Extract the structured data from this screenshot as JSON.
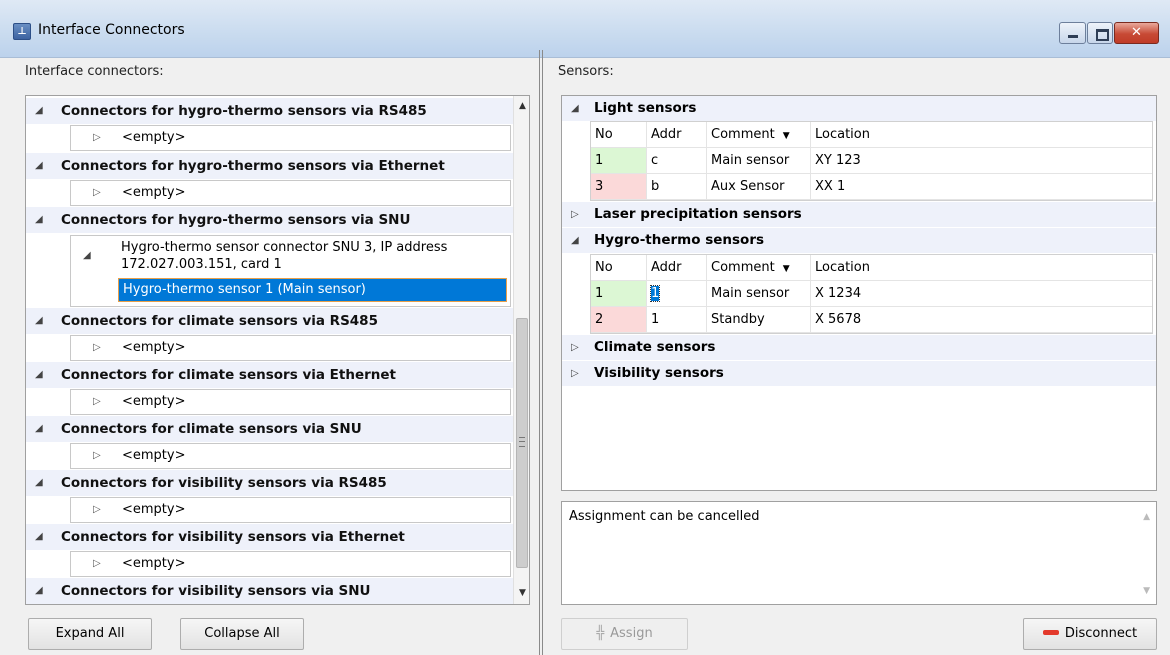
{
  "window": {
    "title": "Interface Connectors",
    "close_glyph": "✕"
  },
  "left": {
    "label": "Interface connectors:",
    "groups": [
      {
        "label": "Connectors for hygro-thermo sensors via RS485",
        "child": "<empty>"
      },
      {
        "label": "Connectors for hygro-thermo sensors via Ethernet",
        "child": "<empty>"
      },
      {
        "label": "Connectors for hygro-thermo sensors via SNU",
        "child": "Hygro-thermo sensor connector SNU 3, IP address 172.027.003.151, card 1",
        "selected": "Hygro-thermo sensor 1 (Main sensor)"
      },
      {
        "label": "Connectors for climate sensors via RS485",
        "child": "<empty>"
      },
      {
        "label": "Connectors for climate sensors via Ethernet",
        "child": "<empty>"
      },
      {
        "label": "Connectors for climate sensors via SNU",
        "child": "<empty>"
      },
      {
        "label": "Connectors for visibility sensors via RS485",
        "child": "<empty>"
      },
      {
        "label": "Connectors for visibility sensors via Ethernet",
        "child": "<empty>"
      },
      {
        "label": "Connectors for visibility sensors via SNU"
      }
    ],
    "buttons": {
      "expand": "Expand All",
      "collapse": "Collapse All"
    }
  },
  "right": {
    "label": "Sensors:",
    "headers": {
      "no": "No",
      "addr": "Addr",
      "comment": "Comment",
      "location": "Location"
    },
    "groups": [
      {
        "label": "Light sensors",
        "expanded": true,
        "rows": [
          {
            "no": "1",
            "addr": "c",
            "comment": "Main sensor",
            "location": "XY 123",
            "status": "green"
          },
          {
            "no": "3",
            "addr": "b",
            "comment": "Aux Sensor",
            "location": "XX 1",
            "status": "pink"
          }
        ]
      },
      {
        "label": "Laser precipitation sensors",
        "expanded": false
      },
      {
        "label": "Hygro-thermo sensors",
        "expanded": true,
        "rows": [
          {
            "no": "1",
            "addr": "1",
            "comment": "Main sensor",
            "location": "X 1234",
            "status": "green"
          },
          {
            "no": "2",
            "addr": "1",
            "comment": "Standby",
            "location": "X 5678",
            "status": "pink"
          }
        ]
      },
      {
        "label": "Climate sensors",
        "expanded": false
      },
      {
        "label": "Visibility sensors",
        "expanded": false
      }
    ],
    "info_text": "Assignment can be cancelled",
    "buttons": {
      "assign": "Assign",
      "disconnect": "Disconnect"
    }
  },
  "icons": {
    "expanded": "◢",
    "collapsed": "▷",
    "sort": "▼",
    "scroll_up": "▲",
    "scroll_down": "▼"
  },
  "colors": {
    "selection": "#0078d7",
    "assigned": "#dcf7d4",
    "unassigned": "#fbd9d9",
    "close": "#c74a35"
  }
}
